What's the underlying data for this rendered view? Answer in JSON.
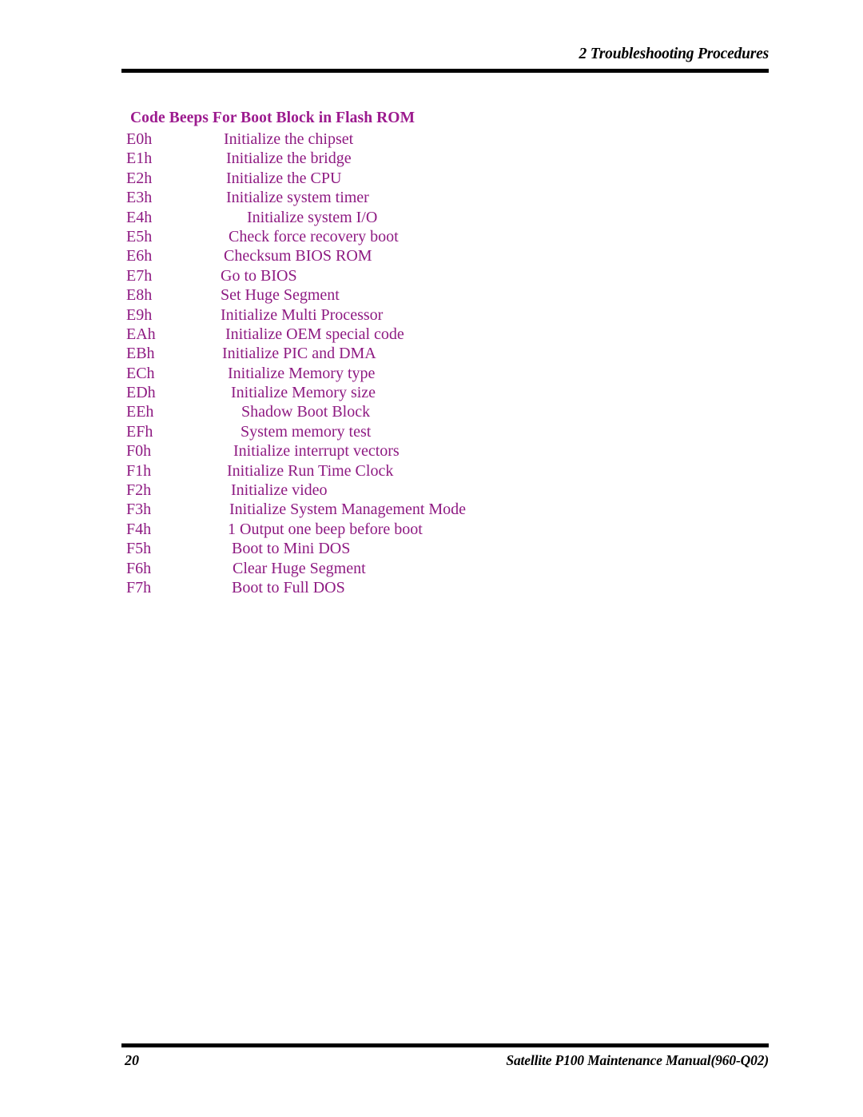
{
  "header": {
    "title": "2 Troubleshooting Procedures"
  },
  "section": {
    "heading": "Code Beeps For Boot Block in Flash ROM"
  },
  "colors": {
    "heading_purple": "#9c1a8e",
    "body_purple": "#8e1a82",
    "rule_black": "#000000",
    "page_background": "#ffffff"
  },
  "code_table": {
    "rows": [
      {
        "code": "E0h",
        "description": "Initialize the chipset",
        "indent": 280
      },
      {
        "code": "E1h",
        "description": "Initialize the bridge",
        "indent": 283
      },
      {
        "code": "E2h",
        "description": "Initialize the CPU",
        "indent": 283
      },
      {
        "code": "E3h",
        "description": "Initialize system timer",
        "indent": 283
      },
      {
        "code": "E4h",
        "description": "Initialize system I/O",
        "indent": 309
      },
      {
        "code": "E5h",
        "description": "Check force recovery boot",
        "indent": 286
      },
      {
        "code": "E6h",
        "description": "Checksum BIOS ROM",
        "indent": 280
      },
      {
        "code": "E7h",
        "description": "Go to BIOS",
        "indent": 276
      },
      {
        "code": "E8h",
        "description": "Set Huge Segment",
        "indent": 276
      },
      {
        "code": "E9h",
        "description": "Initialize Multi Processor",
        "indent": 276
      },
      {
        "code": "EAh",
        "description": "Initialize OEM special code",
        "indent": 282
      },
      {
        "code": "EBh",
        "description": "Initialize PIC and DMA",
        "indent": 278
      },
      {
        "code": "ECh",
        "description": "Initialize Memory type",
        "indent": 285
      },
      {
        "code": "EDh",
        "description": "Initialize Memory size",
        "indent": 289
      },
      {
        "code": "EEh",
        "description": "Shadow Boot Block",
        "indent": 302
      },
      {
        "code": "EFh",
        "description": "System memory test",
        "indent": 301
      },
      {
        "code": "F0h",
        "description": "Initialize interrupt vectors",
        "indent": 292
      },
      {
        "code": "F1h",
        "description": "Initialize Run Time Clock",
        "indent": 284
      },
      {
        "code": "F2h",
        "description": "Initialize video",
        "indent": 289
      },
      {
        "code": "F3h",
        "description": "Initialize System Management Mode",
        "indent": 287
      },
      {
        "code": "F4h",
        "description": "1 Output one beep before boot",
        "indent": 285
      },
      {
        "code": "F5h",
        "description": "Boot to Mini DOS",
        "indent": 290
      },
      {
        "code": "F6h",
        "description": "Clear Huge Segment",
        "indent": 291
      },
      {
        "code": "F7h",
        "description": "Boot to Full DOS",
        "indent": 290
      }
    ]
  },
  "footer": {
    "page_number": "20",
    "manual_title": "Satellite P100 Maintenance Manual(960-Q02)"
  }
}
